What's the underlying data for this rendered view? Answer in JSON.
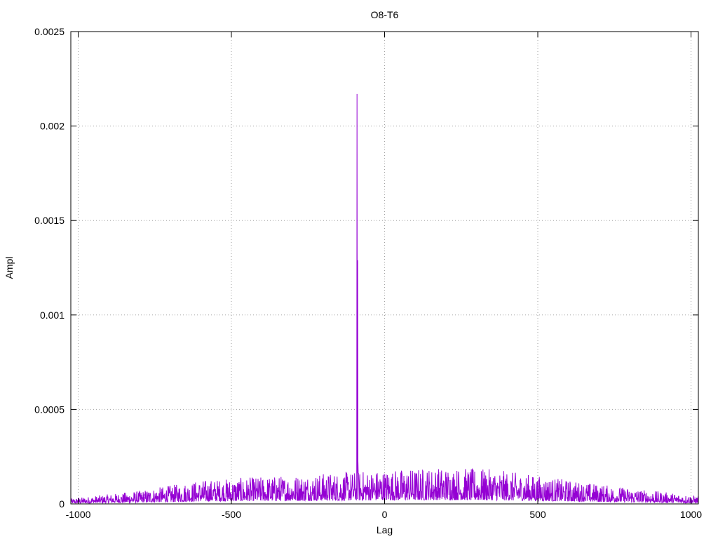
{
  "chart_data": {
    "type": "line",
    "title": "O8-T6",
    "xlabel": "Lag",
    "ylabel": "Ampl",
    "xlim": [
      -1024,
      1024
    ],
    "ylim": [
      0,
      0.0025
    ],
    "x_ticks": [
      -1000,
      -500,
      0,
      500,
      1000
    ],
    "x_tick_labels": [
      "-1000",
      "-500",
      "0",
      "500",
      "1000"
    ],
    "y_ticks": [
      0,
      0.0005,
      0.001,
      0.0015,
      0.002,
      0.0025
    ],
    "y_tick_labels": [
      "0",
      "0.0005",
      "0.001",
      "0.0015",
      "0.002",
      "0.0025"
    ],
    "grid": true,
    "line_color": "#9400d3",
    "peaks": [
      {
        "x": -90,
        "y": 0.00217
      },
      {
        "x": -88,
        "y": 0.00129
      },
      {
        "x": -87,
        "y": 0.00023
      }
    ],
    "noise_envelope": [
      {
        "x": -1024,
        "y": 2e-05
      },
      {
        "x": -800,
        "y": 5e-05
      },
      {
        "x": -600,
        "y": 9e-05
      },
      {
        "x": -300,
        "y": 0.00011
      },
      {
        "x": 0,
        "y": 0.00013
      },
      {
        "x": 200,
        "y": 0.00014
      },
      {
        "x": 360,
        "y": 0.00013
      },
      {
        "x": 600,
        "y": 9e-05
      },
      {
        "x": 800,
        "y": 6e-05
      },
      {
        "x": 1024,
        "y": 3e-05
      }
    ],
    "series": [
      {
        "values_description_only": ""
      }
    ]
  }
}
